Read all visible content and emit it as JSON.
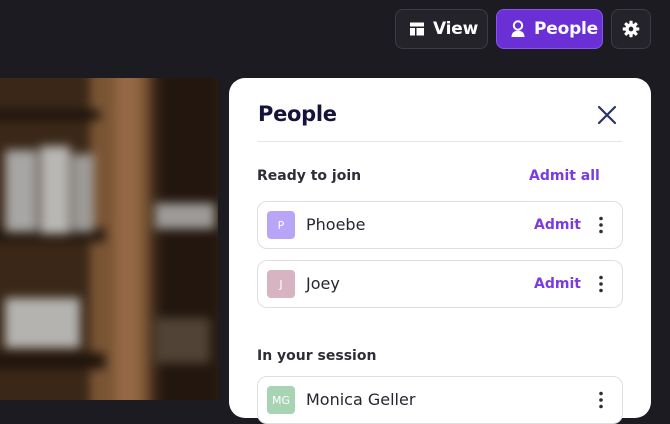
{
  "toolbar": {
    "view_label": "View",
    "people_label": "People",
    "settings_icon": "gear-icon"
  },
  "panel": {
    "title": "People",
    "waiting": {
      "label": "Ready to join",
      "admit_all_label": "Admit all",
      "people": [
        {
          "initial": "P",
          "name": "Phoebe",
          "action": "Admit",
          "avatar_color": "#b9a5f7"
        },
        {
          "initial": "J",
          "name": "Joey",
          "action": "Admit",
          "avatar_color": "#d8b4c3"
        }
      ]
    },
    "session": {
      "label": "In your session",
      "people": [
        {
          "initial": "MG",
          "name": "Monica Geller",
          "avatar_color": "#a8d4b4"
        }
      ]
    }
  },
  "colors": {
    "accent": "#6b2fd6",
    "link": "#7a3ce0",
    "background": "#1c1b21"
  }
}
